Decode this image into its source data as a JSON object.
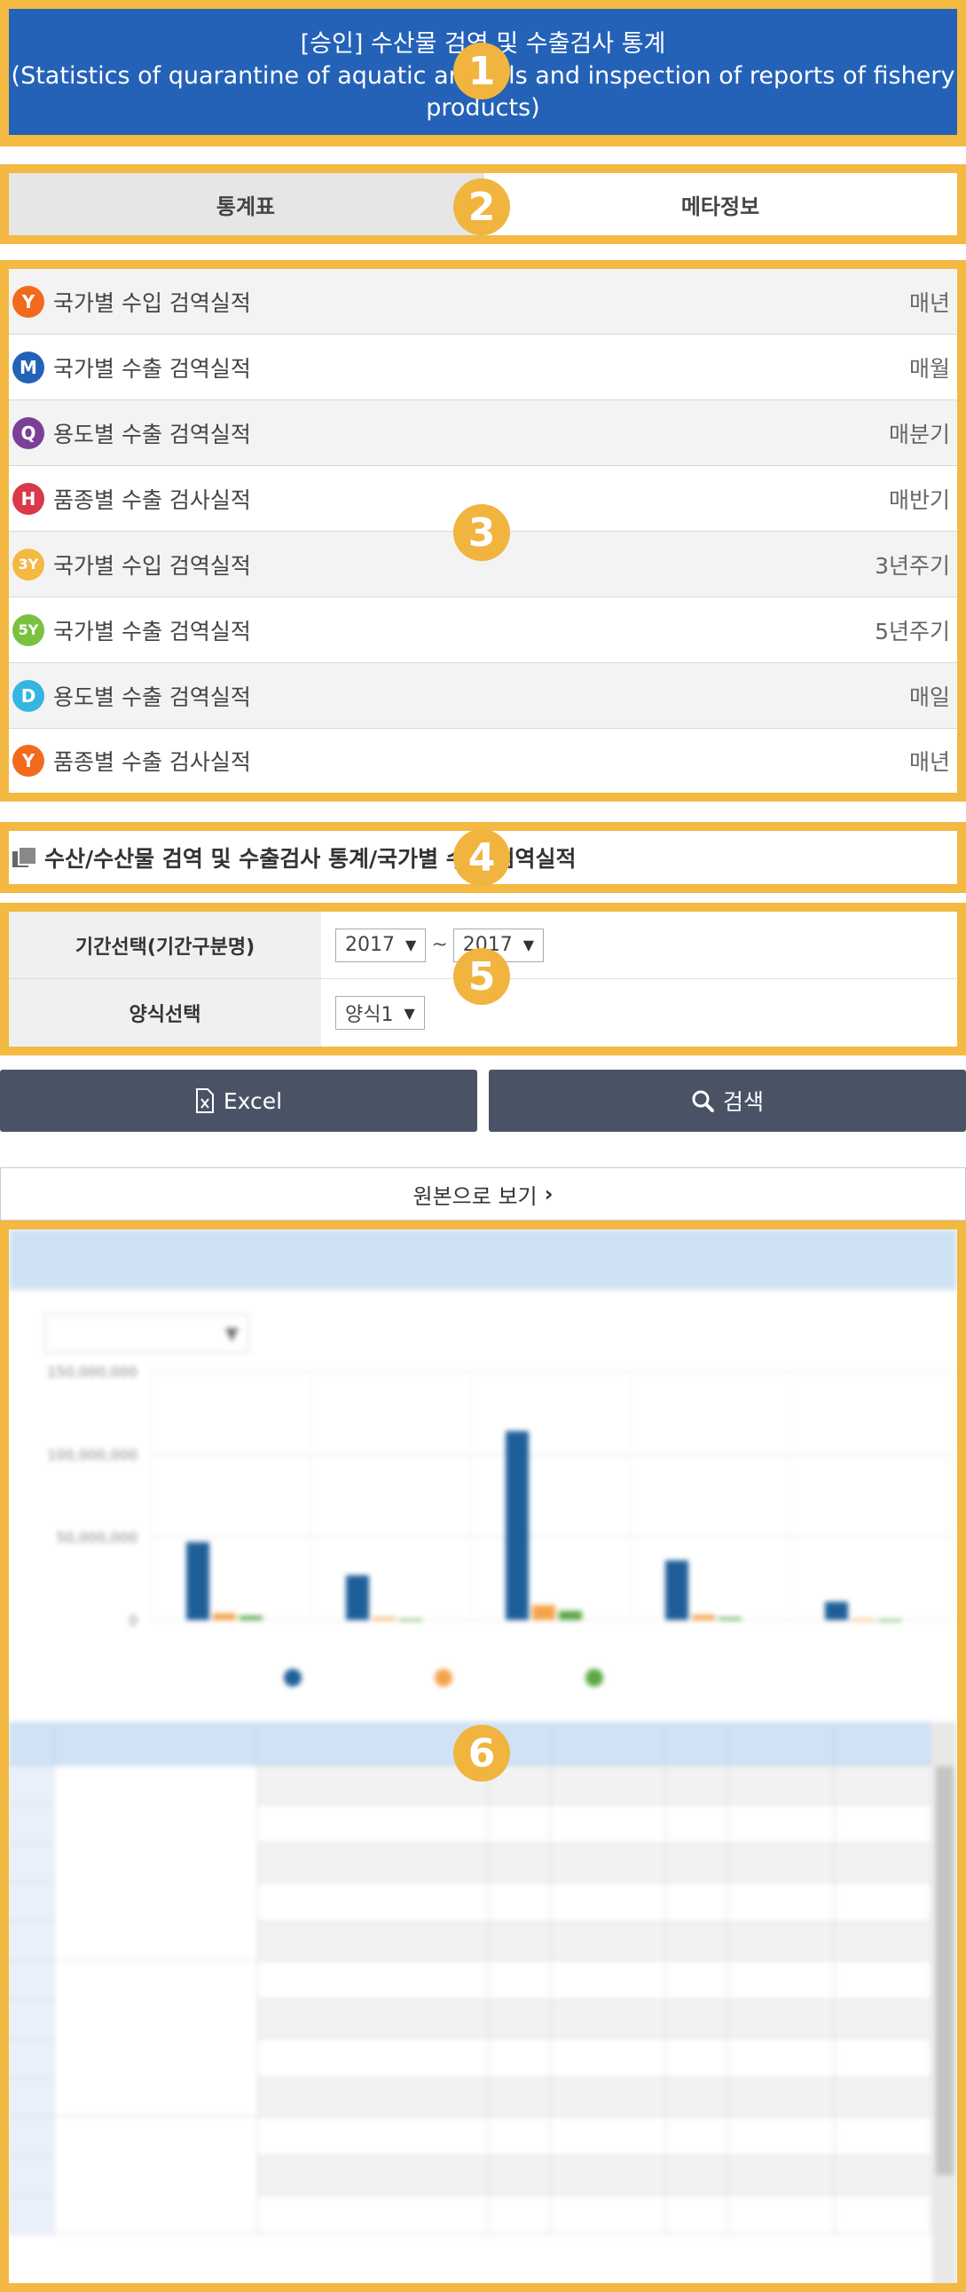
{
  "header": {
    "title_line1": "[승인] 수산물 검역 및 수출검사 통계",
    "title_line2": "(Statistics of quarantine of aquatic animals and inspection of reports of fishery products)"
  },
  "badges": [
    "1",
    "2",
    "3",
    "4",
    "5",
    "6"
  ],
  "tabs": [
    {
      "label": "통계표",
      "active": true
    },
    {
      "label": "메타정보",
      "active": false
    }
  ],
  "stats_list": [
    {
      "icon": "Y",
      "color": "#f26a1b",
      "label": "국가별 수입 검역실적",
      "frequency": "매년"
    },
    {
      "icon": "M",
      "color": "#2462b8",
      "label": "국가별 수출 검역실적",
      "frequency": "매월"
    },
    {
      "icon": "Q",
      "color": "#7b3f98",
      "label": "용도별 수출 검역실적",
      "frequency": "매분기"
    },
    {
      "icon": "H",
      "color": "#d9394b",
      "label": "품종별 수출 검사실적",
      "frequency": "매반기"
    },
    {
      "icon": "3Y",
      "color": "#f3b942",
      "label": "국가별 수입 검역실적",
      "frequency": "3년주기"
    },
    {
      "icon": "5Y",
      "color": "#7ac142",
      "label": "국가별 수출 검역실적",
      "frequency": "5년주기"
    },
    {
      "icon": "D",
      "color": "#35b6e0",
      "label": "용도별 수출 검역실적",
      "frequency": "매일"
    },
    {
      "icon": "Y",
      "color": "#f26a1b",
      "label": "품종별 수출 검사실적",
      "frequency": "매년"
    }
  ],
  "breadcrumb": "수산/수산물 검역 및 수출검사 통계/국가별 수출 검역실적",
  "filters": {
    "period_label": "기간선택(기간구분명)",
    "period_from": "2017",
    "period_sep": "~",
    "period_to": "2017",
    "format_label": "양식선택",
    "format_value": "양식1"
  },
  "buttons": {
    "excel": "Excel",
    "search": "검색"
  },
  "original_link": "원본으로 보기",
  "chart_data": {
    "type": "bar",
    "categories": [
      "",
      "",
      "",
      "",
      ""
    ],
    "series": [
      {
        "name": "",
        "color": "#1f5f99",
        "values": [
          47000000,
          27000000,
          114000000,
          36000000,
          11000000
        ]
      },
      {
        "name": "",
        "color": "#f5a34a",
        "values": [
          4000000,
          1500000,
          9000000,
          3000000,
          500000
        ]
      },
      {
        "name": "",
        "color": "#5aa845",
        "values": [
          2500000,
          500000,
          5500000,
          1500000,
          300000
        ]
      }
    ],
    "ylim": [
      0,
      150000000
    ],
    "yticks": [
      "150,000,000",
      "100,000,000",
      "50,000,000",
      "0"
    ]
  },
  "colors": {
    "accent_frame": "#f3b942",
    "title_bg": "#2462b8",
    "button_bg": "#4a5366"
  }
}
